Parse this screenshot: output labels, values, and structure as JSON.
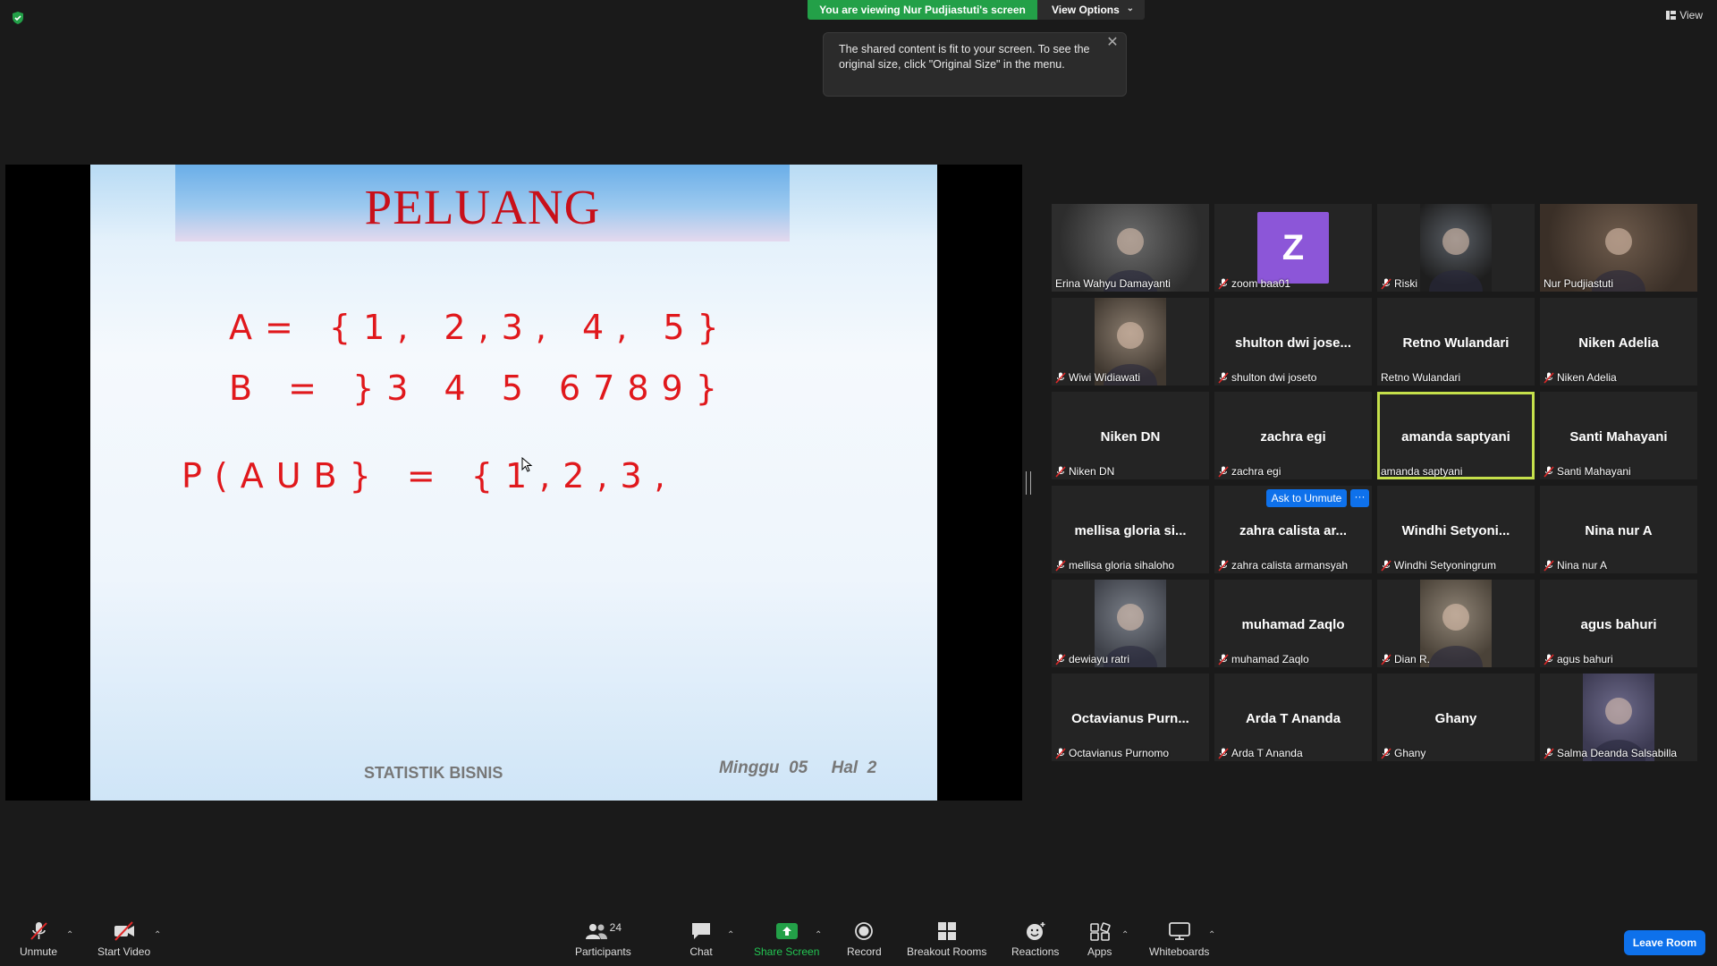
{
  "banner": {
    "viewing_text": "You are viewing Nur Pudjiastuti's screen",
    "view_options_label": "View Options",
    "view_label": "View"
  },
  "tooltip": {
    "text": "The shared content is fit to your screen. To see the original size, click \"Original Size\" in the menu."
  },
  "slide": {
    "title": "PELUANG",
    "line_a": "A= {1, 2,3, 4, 5}",
    "line_b": "B = }3 4 5 6789}",
    "line_union": "P(AUB} = {1,2,3,",
    "footer_left": "STATISTIK BISNIS",
    "footer_right": "Minggu  05     Hal  2"
  },
  "gallery": {
    "tiles": [
      {
        "name": "Erina Wahyu Damayanti",
        "muted": false,
        "video": true
      },
      {
        "name": "zoom baa01",
        "muted": true,
        "avatar": "Z"
      },
      {
        "name": "Riski",
        "muted": true,
        "video": true
      },
      {
        "name": "Nur Pudjiastuti",
        "muted": false,
        "video": true
      },
      {
        "name": "Wiwi Widiawati",
        "muted": true,
        "video": true
      },
      {
        "name": "shulton dwi joseto",
        "display": "shulton dwi jose...",
        "muted": true
      },
      {
        "name": "Retno Wulandari",
        "display": "Retno Wulandari",
        "muted": false
      },
      {
        "name": "Niken Adelia",
        "display": "Niken Adelia",
        "muted": true
      },
      {
        "name": "Niken DN",
        "display": "Niken DN",
        "muted": true
      },
      {
        "name": "zachra egi",
        "display": "zachra egi",
        "muted": true
      },
      {
        "name": "amanda saptyani",
        "display": "amanda saptyani",
        "muted": false,
        "active_speaker": true
      },
      {
        "name": "Santi Mahayani",
        "display": "Santi Mahayani",
        "muted": true
      },
      {
        "name": "mellisa gloria sihaloho",
        "display": "mellisa gloria si...",
        "muted": true
      },
      {
        "name": "zahra calista armansyah",
        "display": "zahra calista ar...",
        "muted": true
      },
      {
        "name": "Windhi Setyoningrum",
        "display": "Windhi Setyoni...",
        "muted": true
      },
      {
        "name": "Nina nur A",
        "display": "Nina nur A",
        "muted": true
      },
      {
        "name": "dewiayu ratri",
        "muted": true,
        "video": true
      },
      {
        "name": "muhamad Zaqlo",
        "display": "muhamad Zaqlo",
        "muted": true
      },
      {
        "name": "Dian R.",
        "muted": true,
        "video": true
      },
      {
        "name": "agus bahuri",
        "display": "agus bahuri",
        "muted": true
      },
      {
        "name": "Octavianus Purnomo",
        "display": "Octavianus Purn...",
        "muted": true
      },
      {
        "name": "Arda T Ananda",
        "display": "Arda T Ananda",
        "muted": true
      },
      {
        "name": "Ghany",
        "display": "Ghany",
        "muted": true
      },
      {
        "name": "Salma Deanda Salsabilla",
        "muted": true,
        "video": true
      }
    ],
    "ask_to_unmute_label": "Ask to Unmute",
    "more_label": "···"
  },
  "toolbar": {
    "unmute": "Unmute",
    "start_video": "Start Video",
    "participants": "Participants",
    "participants_count": "24",
    "chat": "Chat",
    "share_screen": "Share Screen",
    "record": "Record",
    "breakout_rooms": "Breakout Rooms",
    "reactions": "Reactions",
    "apps": "Apps",
    "whiteboards": "Whiteboards",
    "leave_room": "Leave Room"
  },
  "colors": {
    "accent_green": "#23a048",
    "active_speaker": "#c5e04b",
    "zoom_blue": "#0e71eb",
    "title_red": "#c8101a",
    "handwriting_red": "#e0181c",
    "mute_red": "#e02828",
    "avatar_purple": "#8c56d8"
  }
}
